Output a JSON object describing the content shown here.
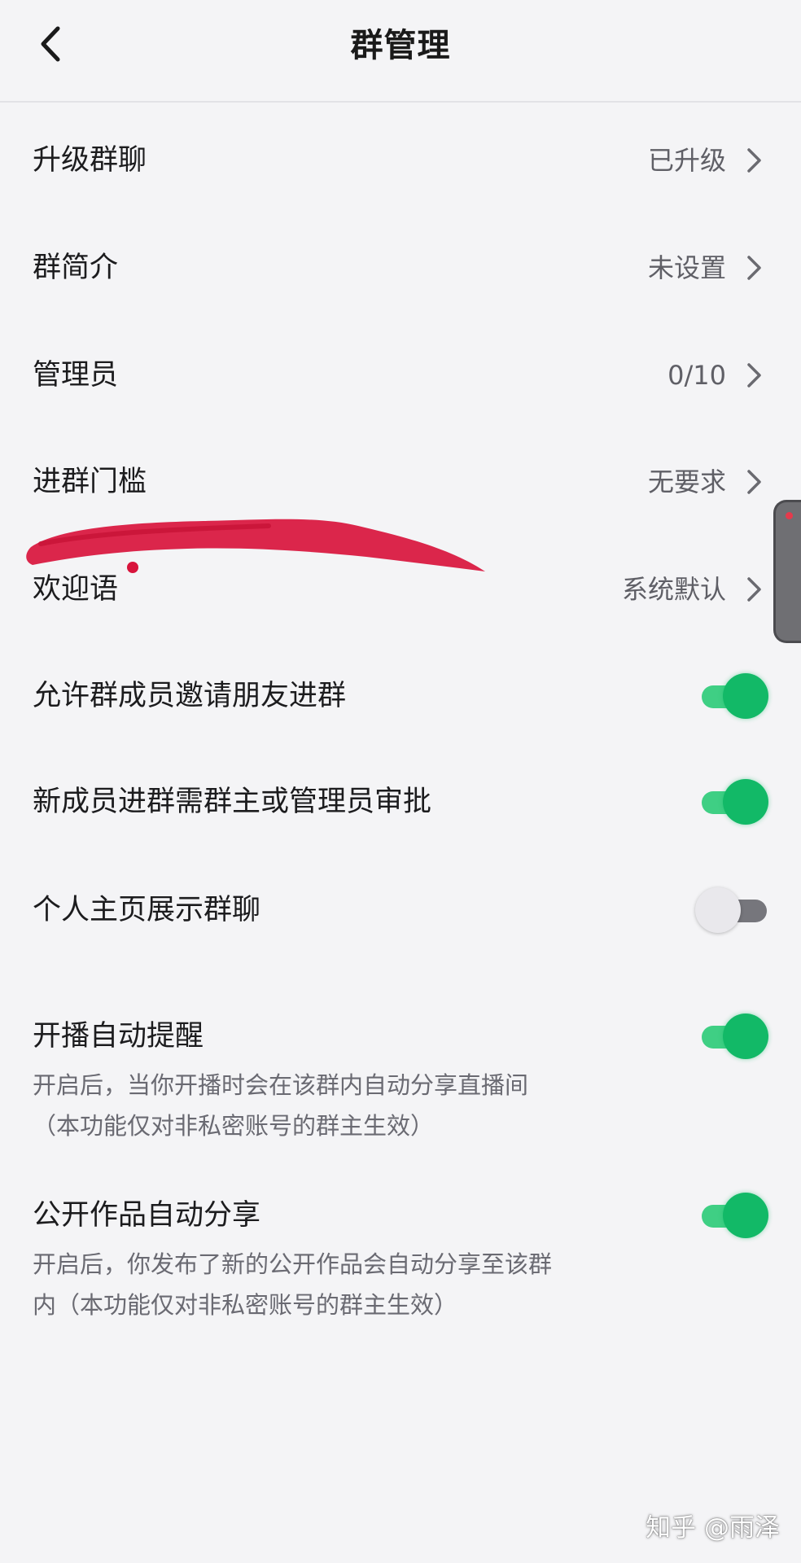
{
  "header": {
    "back_icon": "chevron-left-icon",
    "title": "群管理"
  },
  "nav_rows": [
    {
      "label": "升级群聊",
      "value": "已升级",
      "icon": "chevron-right-icon"
    },
    {
      "label": "群简介",
      "value": "未设置",
      "icon": "chevron-right-icon"
    },
    {
      "label": "管理员",
      "value": "0/10",
      "icon": "chevron-right-icon"
    },
    {
      "label": "进群门槛",
      "value": "无要求",
      "icon": "chevron-right-icon"
    },
    {
      "label": "欢迎语",
      "value": "系统默认",
      "icon": "chevron-right-icon"
    }
  ],
  "toggles": [
    {
      "label": "允许群成员邀请朋友进群",
      "on": true
    },
    {
      "label": "新成员进群需群主或管理员审批",
      "on": true
    },
    {
      "label": "个人主页展示群聊",
      "on": false
    },
    {
      "label": "开播自动提醒",
      "on": true,
      "description": [
        "开启后，当你开播时会在该群内自动分享直播间",
        "（本功能仅对非私密账号的群主生效）"
      ]
    },
    {
      "label": "公开作品自动分享",
      "on": true,
      "description": [
        "开启后，你发布了新的公开作品会自动分享至该群",
        "内（本功能仅对非私密账号的群主生效）"
      ]
    }
  ],
  "colors": {
    "switch_on": "#12b967",
    "switch_off_track": "#76767c",
    "scribble": "#d8143c",
    "background": "#f4f4f6"
  },
  "watermark": "知乎 @雨泽"
}
